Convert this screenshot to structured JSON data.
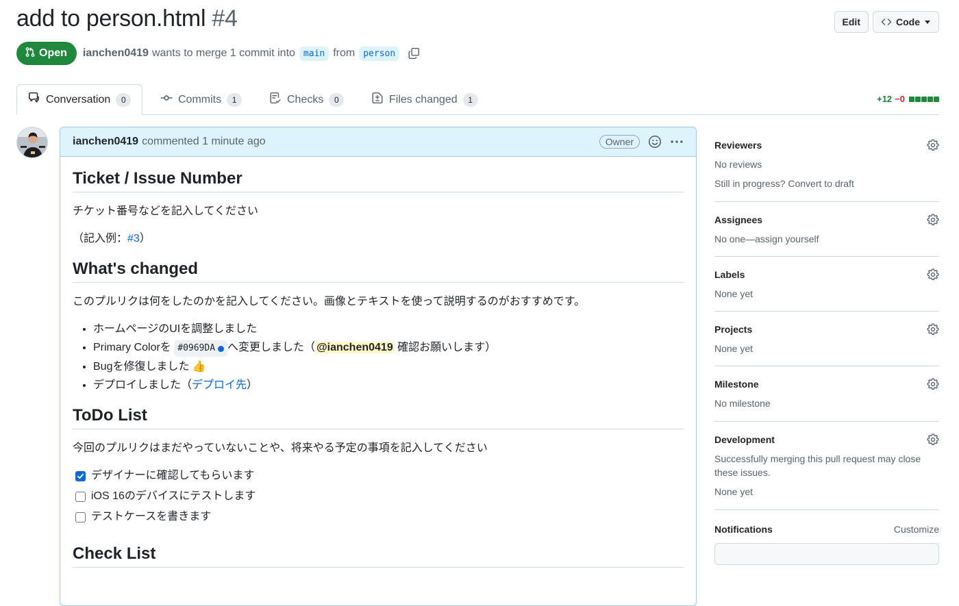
{
  "header": {
    "title": "add to person.html",
    "number": "#4",
    "edit_label": "Edit",
    "code_label": "Code"
  },
  "meta": {
    "state": "Open",
    "author": "ianchen0419",
    "merge_text": "wants to merge 1 commit into",
    "base_branch": "main",
    "from_text": "from",
    "head_branch": "person"
  },
  "tabs": [
    {
      "label": "Conversation",
      "count": "0",
      "icon": "comment-icon"
    },
    {
      "label": "Commits",
      "count": "1",
      "icon": "commit-icon"
    },
    {
      "label": "Checks",
      "count": "0",
      "icon": "checklist-icon"
    },
    {
      "label": "Files changed",
      "count": "1",
      "icon": "file-diff-icon"
    }
  ],
  "diffstat": {
    "additions": "+12",
    "deletions": "−0",
    "blocks": 5
  },
  "comment": {
    "author": "ianchen0419",
    "action": "commented",
    "time": "1 minute ago",
    "badge": "Owner",
    "sections": {
      "ticket": {
        "heading": "Ticket / Issue Number",
        "p1": "チケット番号などを記入してください",
        "p2_prefix": "（記入例：",
        "p2_link": "#3",
        "p2_suffix": "）"
      },
      "changed": {
        "heading": "What's changed",
        "p1": "このプルリクは何をしたのかを記入してください。画像とテキストを使って説明するのがおすすめです。",
        "items": {
          "i1": "ホームページのUIを調整しました",
          "i2_a": "Primary Colorを",
          "i2_code": "#0969DA",
          "i2_b": "へ変更しました（",
          "i2_mention": "@ianchen0419",
          "i2_c": "確認お願いします）",
          "i3": "Bugを修復しました 👍",
          "i4_a": "デプロイしました（",
          "i4_link": "デプロイ先",
          "i4_b": "）"
        }
      },
      "todo": {
        "heading": "ToDo List",
        "p1": "今回のプルリクはまだやっていないことや、将来やる予定の事項を記入してください",
        "tasks": [
          {
            "label": "デザイナーに確認してもらいます",
            "checked": true
          },
          {
            "label": "iOS 16のデバイスにテストします",
            "checked": false
          },
          {
            "label": "テストケースを書きます",
            "checked": false
          }
        ]
      },
      "check": {
        "heading": "Check List"
      }
    }
  },
  "sidebar": {
    "reviewers": {
      "title": "Reviewers",
      "text": "No reviews",
      "draft": "Still in progress? Convert to draft"
    },
    "assignees": {
      "title": "Assignees",
      "text": "No one—assign yourself"
    },
    "labels": {
      "title": "Labels",
      "text": "None yet"
    },
    "projects": {
      "title": "Projects",
      "text": "None yet"
    },
    "milestone": {
      "title": "Milestone",
      "text": "No milestone"
    },
    "development": {
      "title": "Development",
      "text": "Successfully merging this pull request may close these issues.",
      "text2": "None yet"
    },
    "notifications": {
      "title": "Notifications",
      "customize": "Customize"
    }
  },
  "colors": {
    "accent": "#0969da",
    "open": "#1f883d",
    "comment_header": "#ddf4ff",
    "addition": "#1a7f37",
    "deletion": "#d1242f"
  }
}
